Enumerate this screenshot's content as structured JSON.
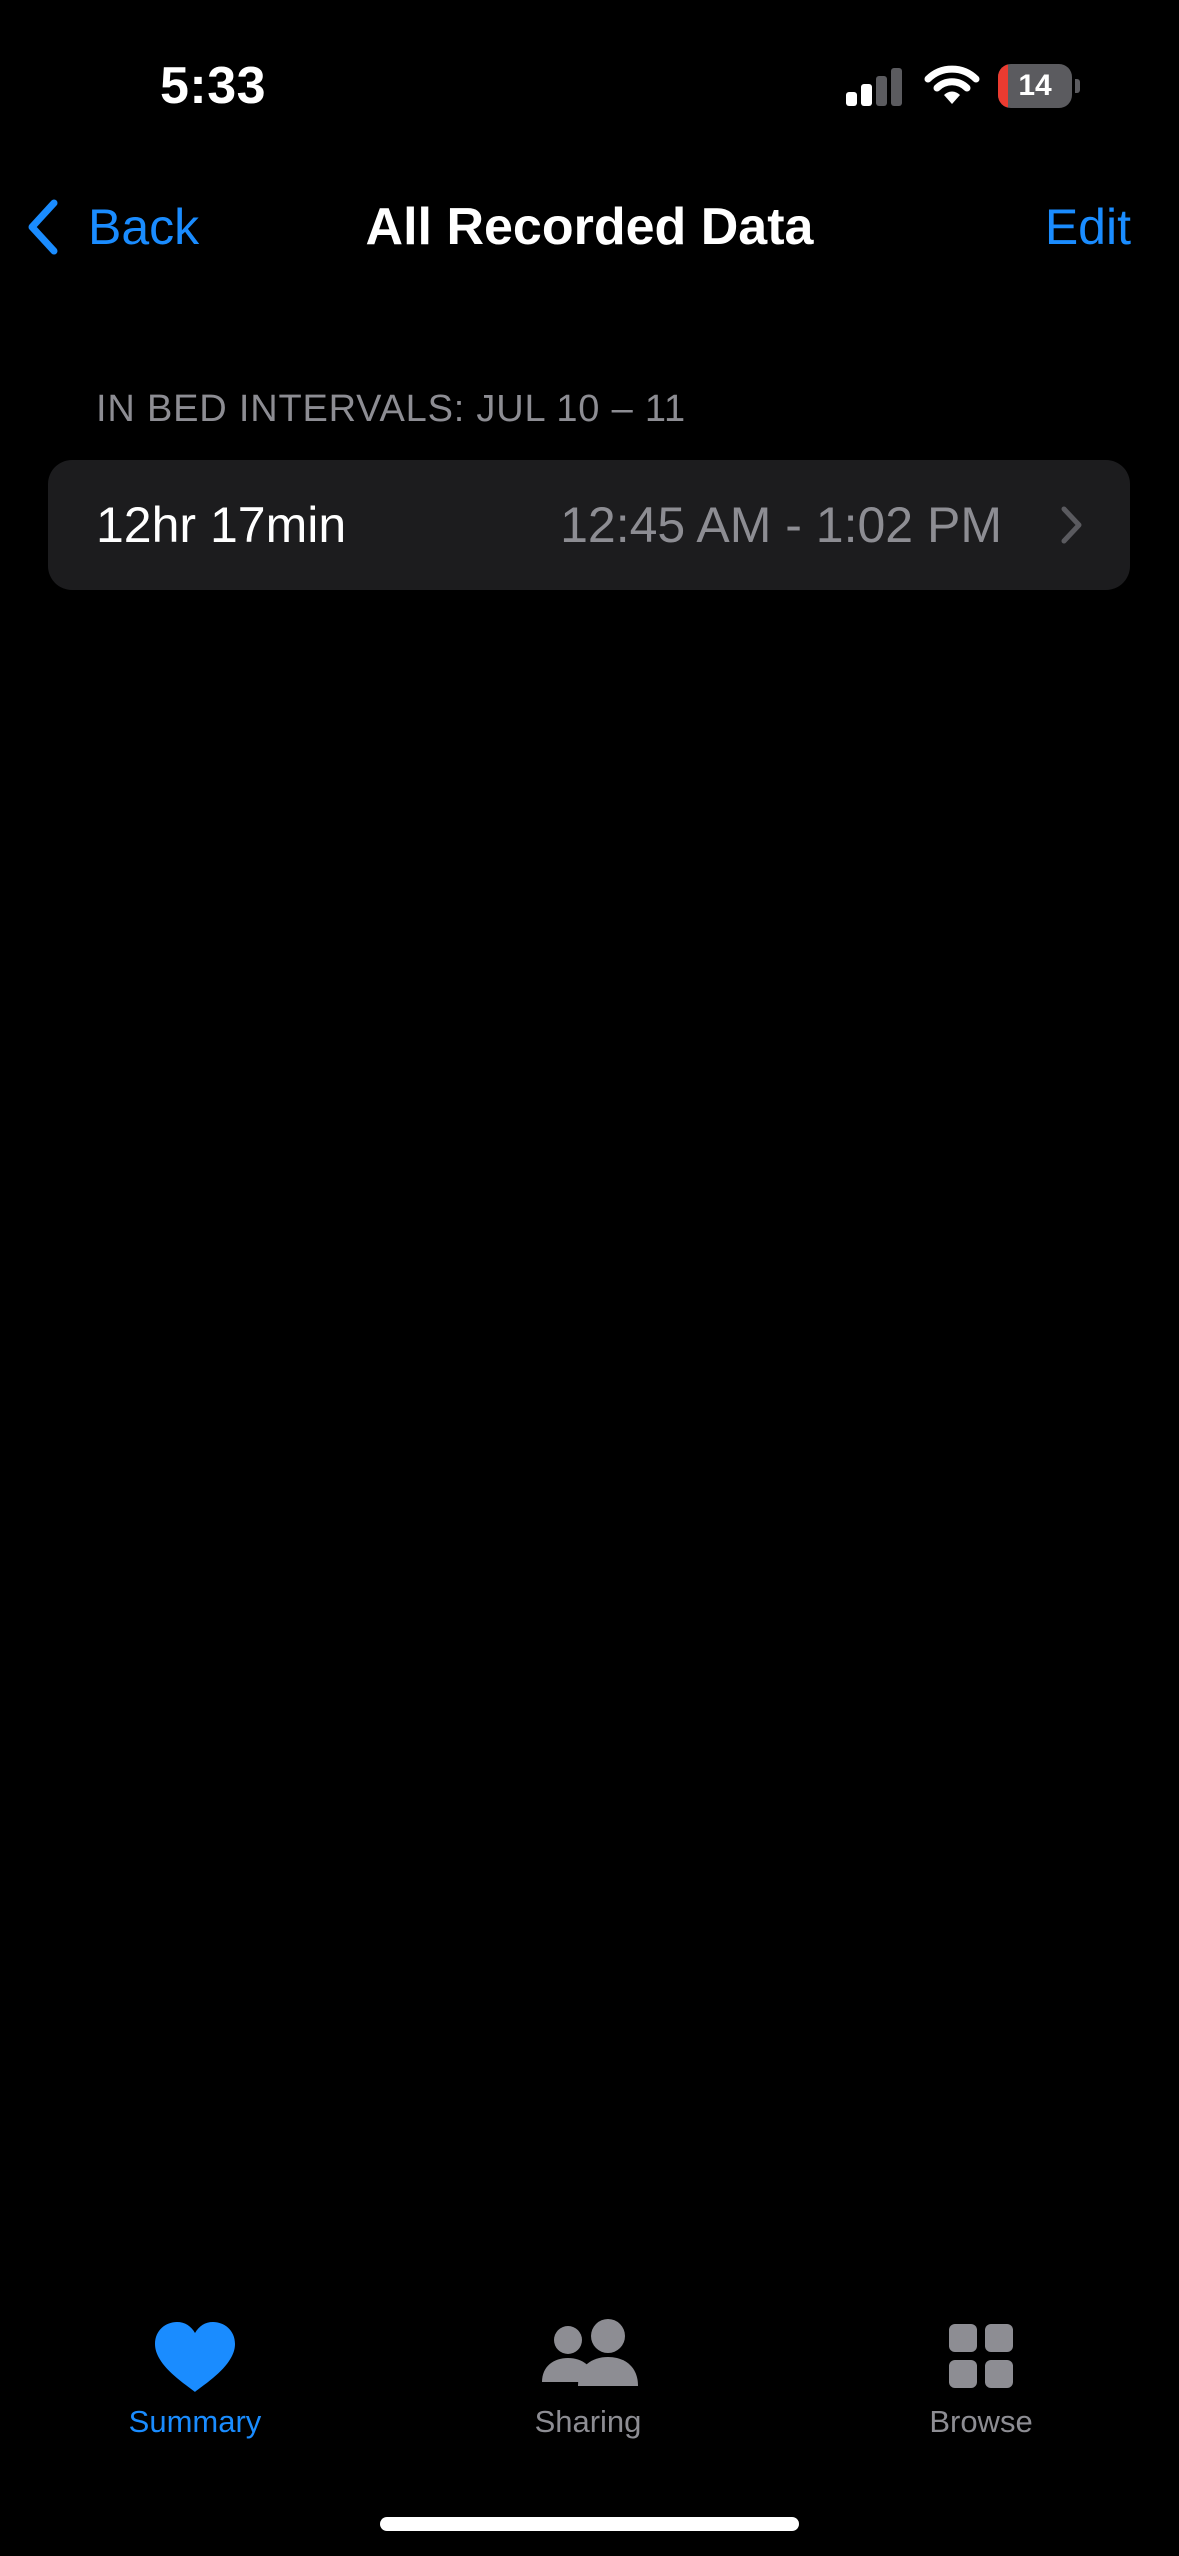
{
  "status_bar": {
    "time": "5:33",
    "battery_level": "14",
    "battery_fraction": 0.14,
    "signal_bars_active": 2,
    "signal_bars_total": 4,
    "icons": [
      "cellular-signal-icon",
      "wifi-icon",
      "battery-icon"
    ]
  },
  "nav": {
    "back_label": "Back",
    "title": "All Recorded Data",
    "edit_label": "Edit"
  },
  "section": {
    "header": "IN BED INTERVALS: JUL 10 – 11",
    "rows": [
      {
        "duration": "12hr 17min",
        "range": "12:45 AM - 1:02 PM"
      }
    ]
  },
  "tab_bar": {
    "tabs": [
      {
        "label": "Summary",
        "icon": "heart-icon",
        "active": true
      },
      {
        "label": "Sharing",
        "icon": "people-icon",
        "active": false
      },
      {
        "label": "Browse",
        "icon": "grid-icon",
        "active": false
      }
    ]
  },
  "colors": {
    "accent": "#1a8cff",
    "background": "#000000",
    "card": "#1c1c1e",
    "secondary_text": "#8d8d93",
    "battery_low": "#eb3b30"
  }
}
